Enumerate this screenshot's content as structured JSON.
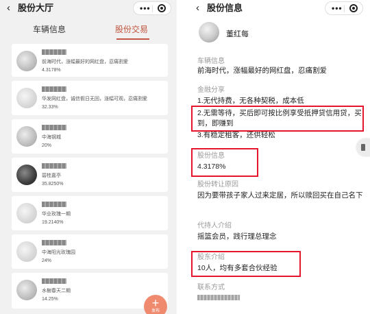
{
  "left_screen": {
    "title": "股份大厅",
    "tabs": [
      {
        "label": "车辆信息",
        "active": false
      },
      {
        "label": "股份交易",
        "active": true
      }
    ],
    "listings": [
      {
        "desc": "前海时代，涨幅最好的网红盘，忍痛割爱",
        "pct": "4.3178%"
      },
      {
        "desc": "华发网红盘，诚信假日无回，涨幅可观，忍痛割爱",
        "pct": "32.33%"
      },
      {
        "desc": "中海钢城",
        "pct": "20%"
      },
      {
        "desc": "碧桂嘉亭",
        "pct": "35.8250%"
      },
      {
        "desc": "华业玫瑰一期",
        "pct": "19.2140%"
      },
      {
        "desc": "中海阳光玫瑰园",
        "pct": "24%"
      },
      {
        "desc": "水榭春天二期",
        "pct": "14.25%"
      }
    ],
    "fab": {
      "symbol": "+",
      "label": "发布"
    }
  },
  "right_screen": {
    "title": "股份信息",
    "username": "董红每",
    "sections": {
      "vehicle_info": {
        "label": "车辆信息",
        "value": "前海时代，涨幅最好的网红盘，忍痛割爱"
      },
      "finance_share": {
        "label": "金融分享",
        "lines": [
          "1.无代持费，无各种契税，成本低",
          "2.无需等待，买后即可按比例享受抵押贷信用贷，买到，即赚到",
          "3.有稳定租客，还供轻松"
        ]
      },
      "share_info": {
        "label": "股份信息",
        "value": "4.3178%"
      },
      "transfer_reason": {
        "label": "股份转让原因",
        "value": "因为要带孩子家人过来定居，所以赎回买在自己名下"
      },
      "agent_intro": {
        "label": "代持人介绍",
        "value": "摇篮会员，践行理总理念"
      },
      "shareholder_intro": {
        "label": "股东介绍",
        "value": "10人，均有多套合伙经验"
      },
      "contact": {
        "label": "联系方式"
      }
    }
  },
  "capsule": {
    "more_glyph": "•••"
  },
  "colors": {
    "accent": "#c2553f",
    "highlight": "#e5132b",
    "fab": "#ef8a6f",
    "muted_label": "#9a9a9a"
  }
}
